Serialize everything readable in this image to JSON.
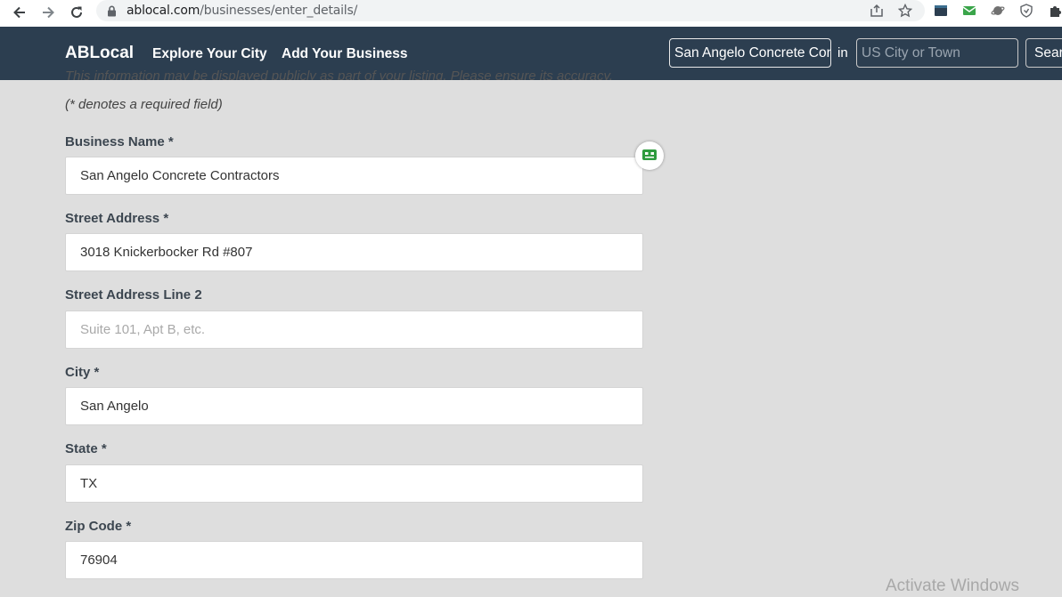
{
  "browser": {
    "url_host": "ablocal.com",
    "url_path": "/businesses/enter_details/",
    "icons": [
      "back-arrow-icon",
      "forward-arrow-icon",
      "reload-icon",
      "lock-icon",
      "share-icon",
      "bookmark-star-icon",
      "extension-icon",
      "puzzle-icon"
    ]
  },
  "header": {
    "brand": "ABLocal",
    "nav": [
      "Explore Your City",
      "Add Your Business"
    ],
    "search_value": "San Angelo Concrete Contractors",
    "in_label": "in",
    "location_placeholder": "US City or Town",
    "search_button": "Search",
    "colors": {
      "bar": "#2c3e50",
      "text": "#ffffff"
    }
  },
  "form": {
    "partial_note": "This information may be displayed publicly as part of your listing. Please ensure its accuracy.",
    "required_note": "(* denotes a required field)",
    "fields": [
      {
        "label": "Business Name *",
        "value": "San Angelo Concrete Contractors",
        "placeholder": ""
      },
      {
        "label": "Street Address *",
        "value": "3018 Knickerbocker Rd #807",
        "placeholder": ""
      },
      {
        "label": "Street Address Line 2",
        "value": "",
        "placeholder": "Suite 101, Apt B, etc."
      },
      {
        "label": "City *",
        "value": "San Angelo",
        "placeholder": ""
      },
      {
        "label": "State *",
        "value": "TX",
        "placeholder": ""
      },
      {
        "label": "Zip Code *",
        "value": "76904",
        "placeholder": ""
      }
    ]
  },
  "overlay": {
    "watermark": "Activate Windows",
    "helper_icon": "password-helper-icon",
    "helper_color": "#2e9b3e"
  }
}
